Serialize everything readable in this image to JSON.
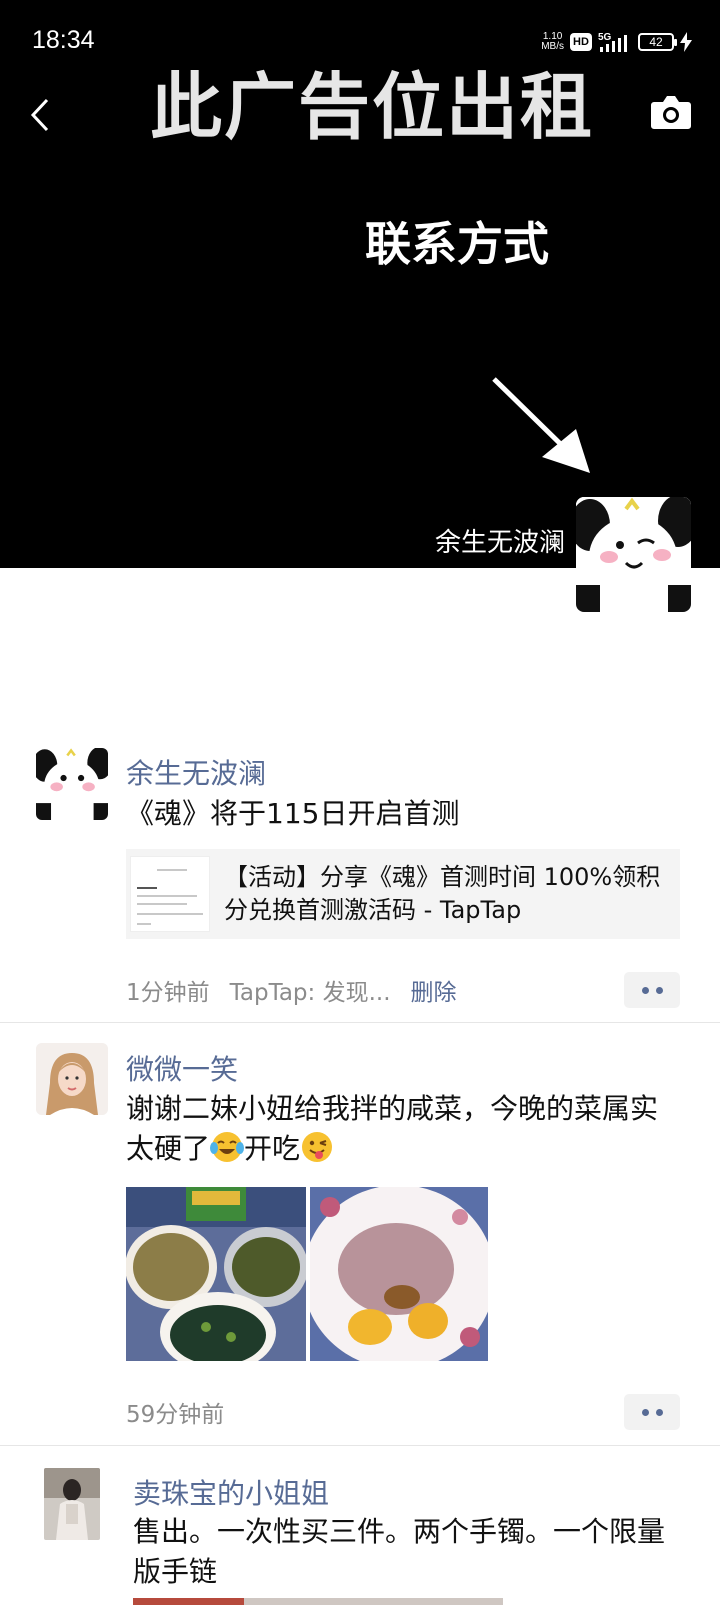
{
  "status_bar": {
    "time": "18:34",
    "net_speed_value": "1.10",
    "net_speed_unit": "MB/s",
    "hd": "HD",
    "network": "5G",
    "battery": "42"
  },
  "cover": {
    "ad_title": "此广告位出租",
    "ad_contact": "联系方式",
    "profile_name": "余生无波澜",
    "back_icon": "chevron-left-icon",
    "camera_icon": "camera-icon"
  },
  "posts": [
    {
      "author": "余生无波澜",
      "text": "《魂》将于115日开启首测",
      "link_title": "【活动】分享《魂》首测时间 100%领积分兑换首测激活码 - TapTap",
      "time": "1分钟前",
      "source": "TapTap: 发现...",
      "delete": "删除"
    },
    {
      "author": "微微一笑",
      "text_before_emoji": "谢谢二妹小妞给我拌的咸菜，今晚的菜属实太硬了",
      "text_between": "开吃",
      "time": "59分钟前"
    },
    {
      "author": "卖珠宝的小姐姐",
      "text": "售出。一次性买三件。两个手镯。一个限量版手链"
    }
  ],
  "colors": {
    "link_blue": "#576b95",
    "meta_gray": "#8b8b8b",
    "cover_bg": "#000000"
  }
}
